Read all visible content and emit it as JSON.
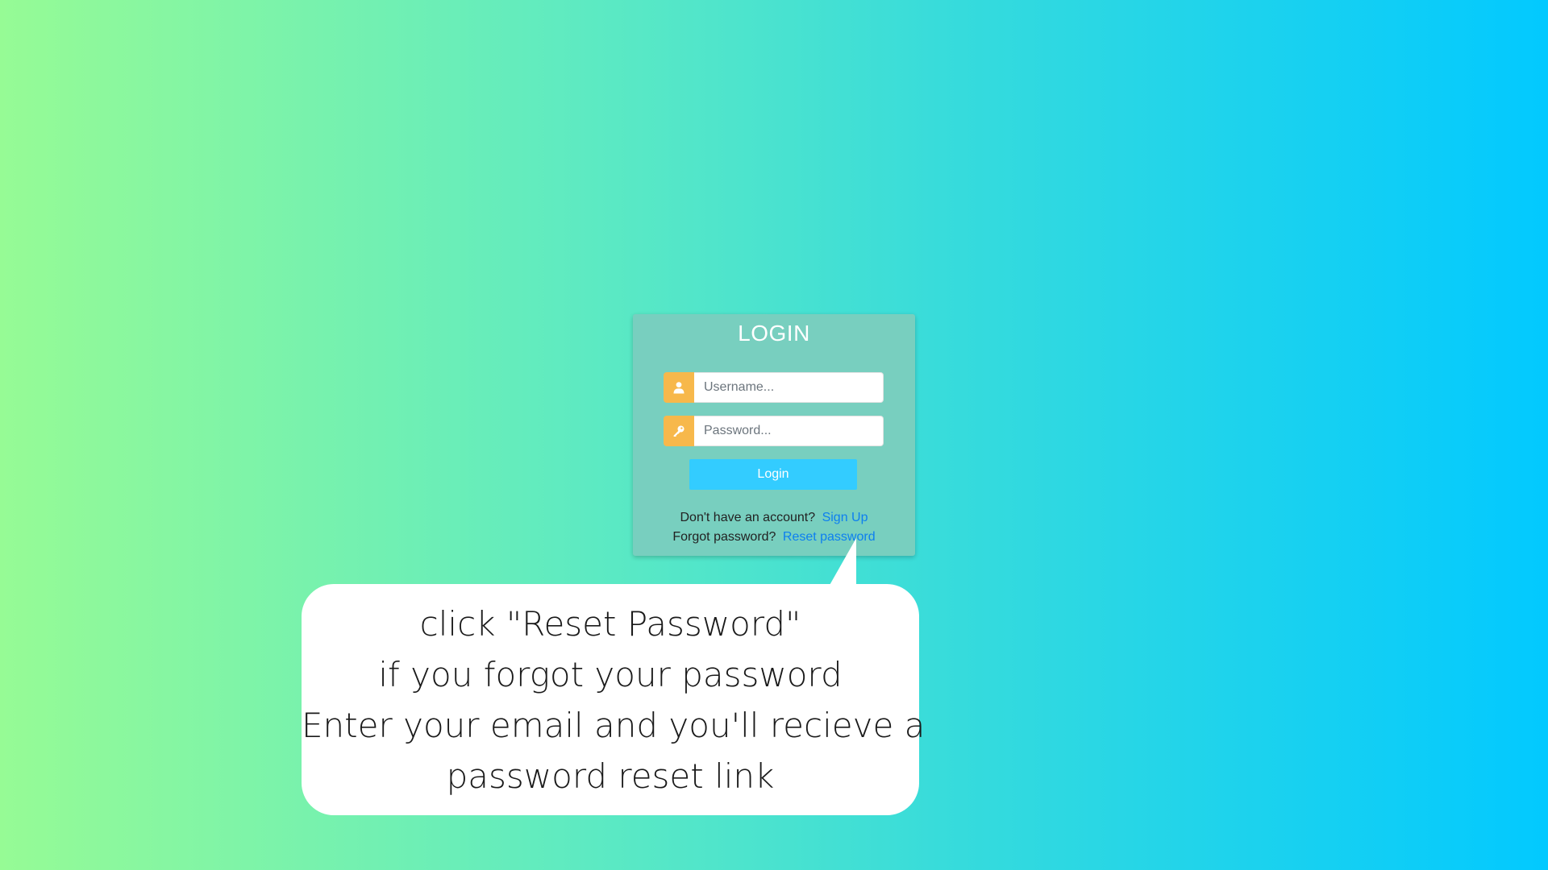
{
  "login": {
    "title": "LOGIN",
    "username_placeholder": "Username...",
    "password_placeholder": "Password...",
    "username_icon": "user-icon",
    "password_icon": "key-icon",
    "login_button": "Login",
    "signup_prompt": "Don't have an account?",
    "signup_link": "Sign Up",
    "reset_prompt": "Forgot password?",
    "reset_link": "Reset password"
  },
  "callout": {
    "lines": [
      "click \"Reset Password\"",
      "if you forgot your password",
      "Enter your email and you'll recieve a",
      "password reset link"
    ]
  },
  "colors": {
    "gradient_start": "#96fb95",
    "gradient_end": "#02c9ff",
    "card": "#78cfbf",
    "icon_addon": "#f7b84b",
    "button": "#33ccff",
    "link": "#0d7ff0"
  }
}
